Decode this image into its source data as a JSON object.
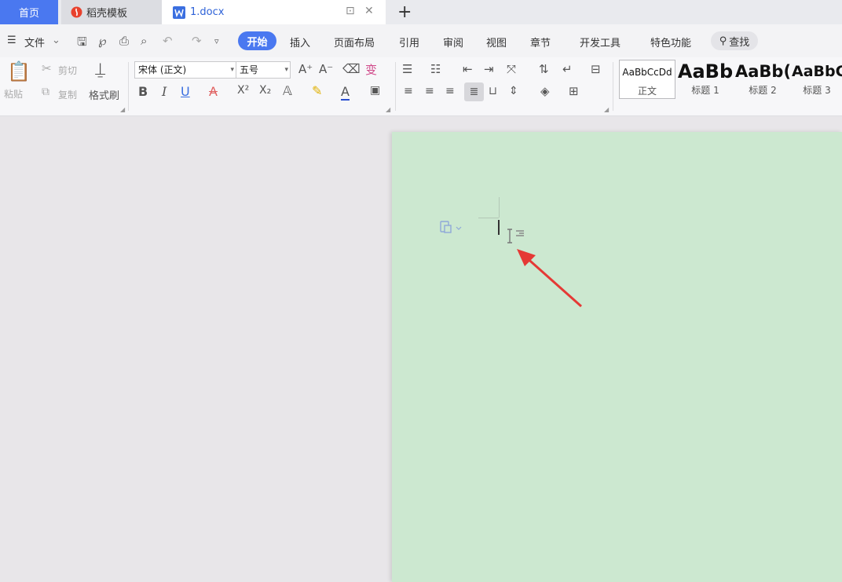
{
  "tabs": {
    "home": "首页",
    "templates": "稻壳模板",
    "document": "1.docx",
    "new_tab": "+"
  },
  "menu": {
    "file": "文件",
    "items": [
      "开始",
      "插入",
      "页面布局",
      "引用",
      "审阅",
      "视图",
      "章节",
      "开发工具",
      "特色功能"
    ],
    "search": "查找"
  },
  "ribbon": {
    "paste": "粘贴",
    "cut": "剪切",
    "copy": "复制",
    "format_painter": "格式刷",
    "font_name": "宋体 (正文)",
    "font_size": "五号",
    "styles": [
      {
        "preview": "AaBbCcDd",
        "name": "正文"
      },
      {
        "preview": "AaBb",
        "name": "标题 1"
      },
      {
        "preview": "AaBb(",
        "name": "标题 2"
      },
      {
        "preview": "AaBbC",
        "name": "标题 3"
      }
    ]
  },
  "colors": {
    "accent": "#4a78f0",
    "page_background": "#cce8d0",
    "canvas_background": "#e8e6e9",
    "arrow": "#e53935"
  }
}
